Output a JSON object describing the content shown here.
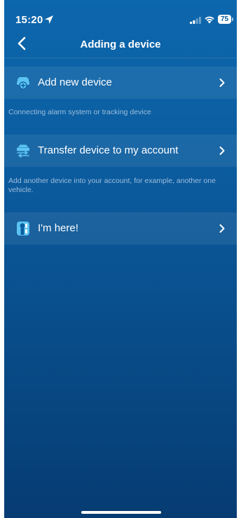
{
  "status_bar": {
    "time": "15:20",
    "battery": "75"
  },
  "nav": {
    "title": "Adding a device",
    "back_icon": "chevron-left-icon"
  },
  "menu": {
    "items": [
      {
        "icon": "add-device-icon",
        "label": "Add new device",
        "description": "Connecting alarm system or tracking device"
      },
      {
        "icon": "transfer-device-icon",
        "label": "Transfer device to my account",
        "description": "Add another device into your account, for example, another one vehicle."
      },
      {
        "icon": "keyfob-icon",
        "label": "I'm here!",
        "description": ""
      }
    ]
  },
  "colors": {
    "background_top": "#0d67ad",
    "background_bottom": "#063c72",
    "icon_accent": "#5cc4f2"
  }
}
